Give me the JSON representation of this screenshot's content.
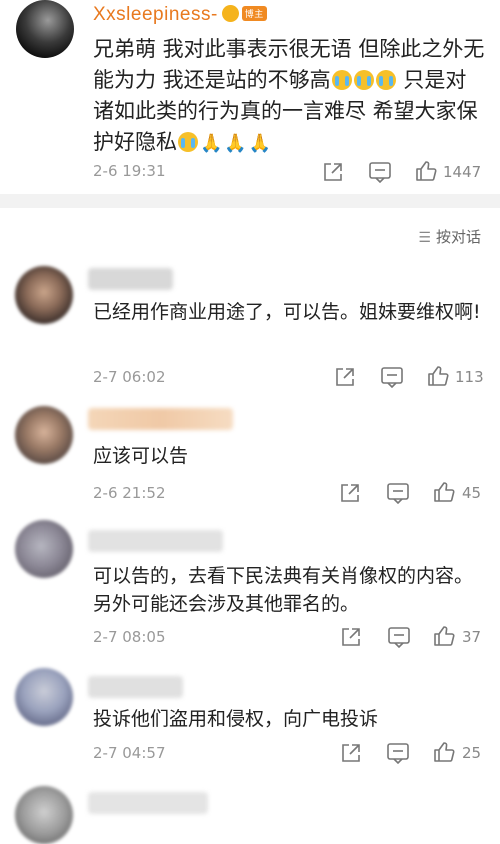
{
  "post": {
    "username": "Xxsleepiness-",
    "badge": "博主",
    "text_line1": "兄弟萌 我对此事表示很无语 但除此之外无",
    "text_line2_a": "能为力 我还是站的不够高",
    "text_line2_b": " 只是对",
    "text_line3": "诸如此类的行为真的一言难尽 希望大家保",
    "text_line4": "护好隐私",
    "time": "2-6 19:31",
    "likes": "1447",
    "icons": [
      "share-icon",
      "comment-icon",
      "like-icon"
    ]
  },
  "sort_label": "按对话",
  "comments": [
    {
      "text": "已经用作商业用途了，可以告。姐妹要维权啊!",
      "time": "2-7 06:02",
      "likes": "113"
    },
    {
      "text": "应该可以告",
      "time": "2-6 21:52",
      "likes": "45"
    },
    {
      "text": "可以告的，去看下民法典有关肖像权的内容。另外可能还会涉及其他罪名的。",
      "time": "2-7 08:05",
      "likes": "37"
    },
    {
      "text": "投诉他们盗用和侵权，向广电投诉",
      "time": "2-7 04:57",
      "likes": "25"
    }
  ],
  "colors": {
    "username": "#e8791f",
    "divider": "#f2f2f2",
    "meta": "#999999"
  }
}
